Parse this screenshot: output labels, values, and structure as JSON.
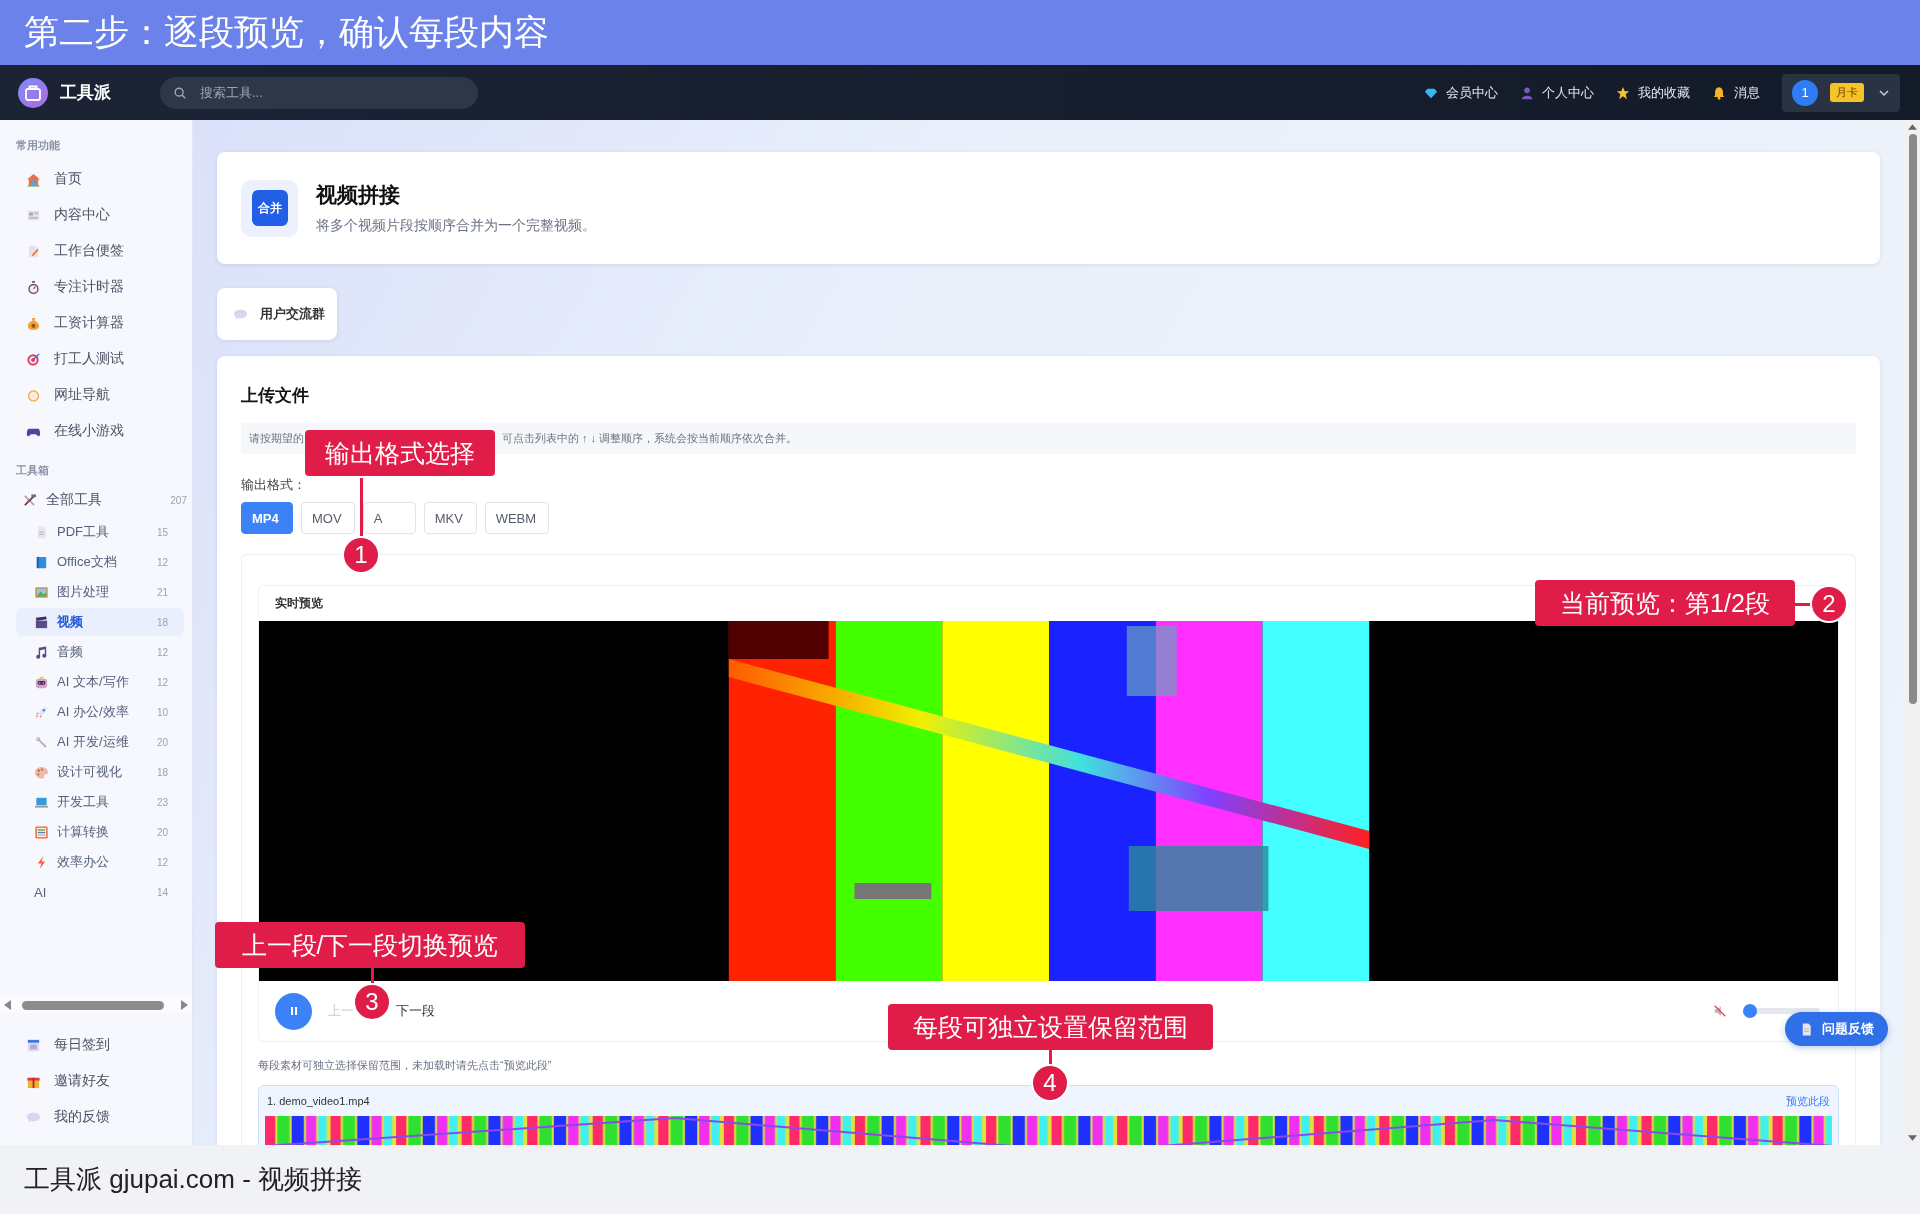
{
  "banner": {
    "title": "第二步：逐段预览，确认每段内容"
  },
  "navbar": {
    "brand": "工具派",
    "search": {
      "placeholder": "搜索工具..."
    },
    "links": [
      {
        "label": "会员中心"
      },
      {
        "label": "个人中心"
      },
      {
        "label": "我的收藏"
      },
      {
        "label": "消息"
      }
    ],
    "user": {
      "avatar": "1",
      "badge": "月卡"
    }
  },
  "sidebar": {
    "common_title": "常用功能",
    "common_items": [
      {
        "label": "首页"
      },
      {
        "label": "内容中心"
      },
      {
        "label": "工作台便签"
      },
      {
        "label": "专注计时器"
      },
      {
        "label": "工资计算器"
      },
      {
        "label": "打工人测试"
      },
      {
        "label": "网址导航"
      },
      {
        "label": "在线小游戏"
      }
    ],
    "toolbox_title": "工具箱",
    "all_tools": {
      "label": "全部工具",
      "count": "207"
    },
    "tool_items": [
      {
        "label": "PDF工具",
        "count": "15",
        "selected": false
      },
      {
        "label": "Office文档",
        "count": "12",
        "selected": false
      },
      {
        "label": "图片处理",
        "count": "21",
        "selected": false
      },
      {
        "label": "视频",
        "count": "18",
        "selected": true
      },
      {
        "label": "音频",
        "count": "12",
        "selected": false
      },
      {
        "label": "AI 文本/写作",
        "count": "12",
        "selected": false
      },
      {
        "label": "AI 办公/效率",
        "count": "10",
        "selected": false
      },
      {
        "label": "AI 开发/运维",
        "count": "20",
        "selected": false
      },
      {
        "label": "设计可视化",
        "count": "18",
        "selected": false
      },
      {
        "label": "开发工具",
        "count": "23",
        "selected": false
      },
      {
        "label": "计算转换",
        "count": "20",
        "selected": false
      },
      {
        "label": "效率办公",
        "count": "12",
        "selected": false
      },
      {
        "label": "AI",
        "count": "14",
        "selected": false
      }
    ],
    "footer_items": [
      {
        "label": "每日签到"
      },
      {
        "label": "邀请好友"
      },
      {
        "label": "我的反馈"
      }
    ]
  },
  "tool": {
    "badge": "合并",
    "title": "视频拼接",
    "description": "将多个视频片段按顺序合并为一个完整视频。"
  },
  "community_button": "用户交流群",
  "upload": {
    "title": "上传文件",
    "hint": [
      "请按期望的",
      "可点击列表中的 ↑ ↓ 调整顺序，系统会按当前顺序依次合并。"
    ],
    "format_label": "输出格式：",
    "formats": [
      {
        "label": "MP4",
        "selected": true
      },
      {
        "label": "MOV",
        "selected": false
      },
      {
        "label": "A",
        "selected": false
      },
      {
        "label": "MKV",
        "selected": false
      },
      {
        "label": "WEBM",
        "selected": false
      }
    ]
  },
  "preview": {
    "title": "实时预览",
    "playing": true,
    "prev": {
      "label": "上一",
      "disabled": true
    },
    "next": {
      "label": "下一段",
      "disabled": false
    },
    "muted": true,
    "volume": {
      "level": 0
    }
  },
  "segment_hint": "每段素材可独立选择保留范围，未加载时请先点击“预览此段”",
  "clips": [
    {
      "name": "1. demo_video1.mp4",
      "action": "预览此段"
    }
  ],
  "feedback_button": "问题反馈",
  "annotations": [
    {
      "number": "1",
      "text": "输出格式选择"
    },
    {
      "number": "2",
      "text": "当前预览：第1/2段"
    },
    {
      "number": "3",
      "text": "上一段/下一段切换预览"
    },
    {
      "number": "4",
      "text": "每段可独立设置保留范围"
    }
  ],
  "caption": "工具派 gjupai.com - 视频拼接"
}
